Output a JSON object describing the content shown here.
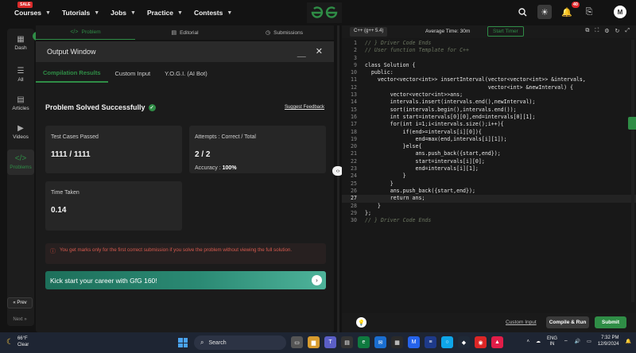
{
  "nav": {
    "items": [
      {
        "label": "Courses",
        "badge": "SALE"
      },
      {
        "label": "Tutorials"
      },
      {
        "label": "Jobs"
      },
      {
        "label": "Practice"
      },
      {
        "label": "Contests"
      }
    ],
    "notification_count": "40",
    "avatar_letter": "M"
  },
  "rail": {
    "items": [
      "Dash",
      "All",
      "Articles",
      "Videos",
      "Problems"
    ],
    "prev": "« Prev",
    "next": "Next »"
  },
  "left_tabs": [
    "Problem",
    "Editorial",
    "Submissions"
  ],
  "output": {
    "title": "Output Window",
    "tabs": [
      "Compilation Results",
      "Custom Input",
      "Y.O.G.I. (AI Bot)"
    ],
    "status": "Problem Solved Successfully",
    "feedback": "Suggest Feedback",
    "cards": {
      "tests": {
        "label": "Test Cases Passed",
        "value": "1111 / 1111"
      },
      "attempts": {
        "label": "Attempts : Correct / Total",
        "value": "2 / 2",
        "accuracy_label": "Accuracy :",
        "accuracy_value": "100%"
      },
      "time": {
        "label": "Time Taken",
        "value": "0.14"
      }
    },
    "warning": "You get marks only for the first correct submission if you solve the problem without viewing the full solution.",
    "banner": "Kick start your career with GfG 160!"
  },
  "editor": {
    "language": "C++ (g++ 5.4)",
    "average_time": "Average Time: 30m",
    "timer": "Start Timer",
    "custom_input": "Custom Input",
    "compile": "Compile & Run",
    "submit": "Submit",
    "lines": [
      {
        "n": "1",
        "t": "// } Driver Code Ends",
        "c": "cm",
        "fold": true
      },
      {
        "n": "2",
        "t": "// User function Template for C++",
        "c": "cm"
      },
      {
        "n": "3",
        "t": "",
        "c": "tx"
      },
      {
        "n": "9",
        "t": "class Solution {",
        "c": "tx"
      },
      {
        "n": "10",
        "t": "  public:",
        "c": "tx"
      },
      {
        "n": "11",
        "t": "    vector<vector<int>> insertInterval(vector<vector<int>> &intervals,",
        "c": "tx"
      },
      {
        "n": "12",
        "t": "                                       vector<int> &newInterval) {",
        "c": "tx"
      },
      {
        "n": "13",
        "t": "        vector<vector<int>>ans;",
        "c": "tx"
      },
      {
        "n": "14",
        "t": "        intervals.insert(intervals.end(),newInterval);",
        "c": "tx"
      },
      {
        "n": "15",
        "t": "        sort(intervals.begin(),intervals.end());",
        "c": "tx"
      },
      {
        "n": "16",
        "t": "        int start=intervals[0][0],end=intervals[0][1];",
        "c": "tx"
      },
      {
        "n": "17",
        "t": "        for(int i=1;i<intervals.size();i++){",
        "c": "tx"
      },
      {
        "n": "18",
        "t": "            if(end>=intervals[i][0]){",
        "c": "tx"
      },
      {
        "n": "19",
        "t": "                end=max(end,intervals[i][1]);",
        "c": "tx"
      },
      {
        "n": "20",
        "t": "            }else{",
        "c": "tx"
      },
      {
        "n": "21",
        "t": "                ans.push_back({start,end});",
        "c": "tx"
      },
      {
        "n": "22",
        "t": "                start=intervals[i][0];",
        "c": "tx"
      },
      {
        "n": "23",
        "t": "                end=intervals[i][1];",
        "c": "tx"
      },
      {
        "n": "24",
        "t": "            }",
        "c": "tx"
      },
      {
        "n": "25",
        "t": "        }",
        "c": "tx"
      },
      {
        "n": "26",
        "t": "        ans.push_back({start,end});",
        "c": "tx"
      },
      {
        "n": "27",
        "t": "        return ans;",
        "c": "tx",
        "current": true
      },
      {
        "n": "28",
        "t": "    }",
        "c": "tx"
      },
      {
        "n": "29",
        "t": "};",
        "c": "tx"
      },
      {
        "n": "30",
        "t": "// } Driver Code Ends",
        "c": "cm",
        "fold": true
      }
    ]
  },
  "taskbar": {
    "temp": "66°F",
    "weather": "Clear",
    "search": "Search",
    "lang": "ENG",
    "region": "IN",
    "time": "7:32 PM",
    "date": "12/9/2024"
  },
  "colors": {
    "accent": "#2f8d46",
    "warning": "#d85a4e"
  }
}
